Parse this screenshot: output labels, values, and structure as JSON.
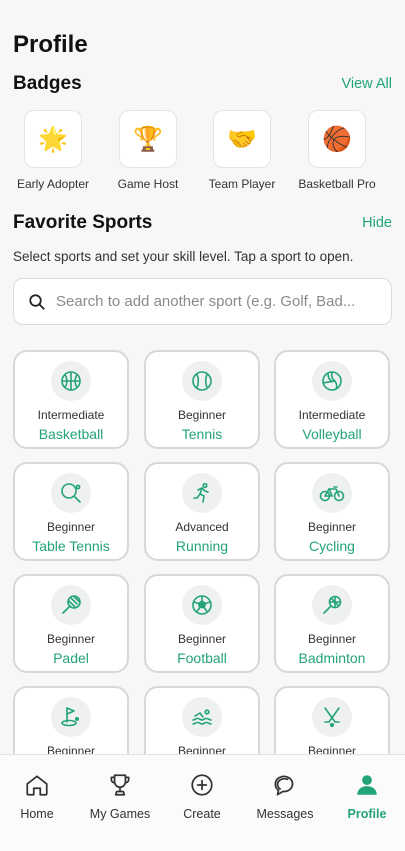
{
  "page": {
    "title": "Profile"
  },
  "badges": {
    "title": "Badges",
    "view_all": "View All",
    "items": [
      {
        "emoji": "🌟",
        "label": "Early Adopter"
      },
      {
        "emoji": "🏆",
        "label": "Game Host"
      },
      {
        "emoji": "🤝",
        "label": "Team Player"
      },
      {
        "emoji": "🏀",
        "label": "Basketball Pro"
      }
    ]
  },
  "favorites": {
    "title": "Favorite Sports",
    "hide": "Hide",
    "hint": "Select sports and set your skill level. Tap a sport to open.",
    "search_placeholder": "Search to add another sport (e.g. Golf, Bad...",
    "sports": [
      {
        "icon": "basketball-icon",
        "level": "Intermediate",
        "name": "Basketball"
      },
      {
        "icon": "tennis-icon",
        "level": "Beginner",
        "name": "Tennis"
      },
      {
        "icon": "volleyball-icon",
        "level": "Intermediate",
        "name": "Volleyball"
      },
      {
        "icon": "table-tennis-icon",
        "level": "Beginner",
        "name": "Table Tennis"
      },
      {
        "icon": "running-icon",
        "level": "Advanced",
        "name": "Running"
      },
      {
        "icon": "cycling-icon",
        "level": "Beginner",
        "name": "Cycling"
      },
      {
        "icon": "padel-icon",
        "level": "Beginner",
        "name": "Padel"
      },
      {
        "icon": "football-icon",
        "level": "Beginner",
        "name": "Football"
      },
      {
        "icon": "badminton-icon",
        "level": "Beginner",
        "name": "Badminton"
      },
      {
        "icon": "golf-icon",
        "level": "Beginner",
        "name": ""
      },
      {
        "icon": "swimming-icon",
        "level": "Beginner",
        "name": ""
      },
      {
        "icon": "hockey-icon",
        "level": "Beginner",
        "name": ""
      }
    ]
  },
  "tabbar": {
    "items": [
      {
        "icon": "home-icon",
        "label": "Home"
      },
      {
        "icon": "trophy-icon",
        "label": "My Games"
      },
      {
        "icon": "plus-circle-icon",
        "label": "Create"
      },
      {
        "icon": "chat-icon",
        "label": "Messages"
      },
      {
        "icon": "user-icon",
        "label": "Profile",
        "active": true
      }
    ]
  },
  "colors": {
    "accent": "#23a37a",
    "background": "#f7f7f7"
  }
}
